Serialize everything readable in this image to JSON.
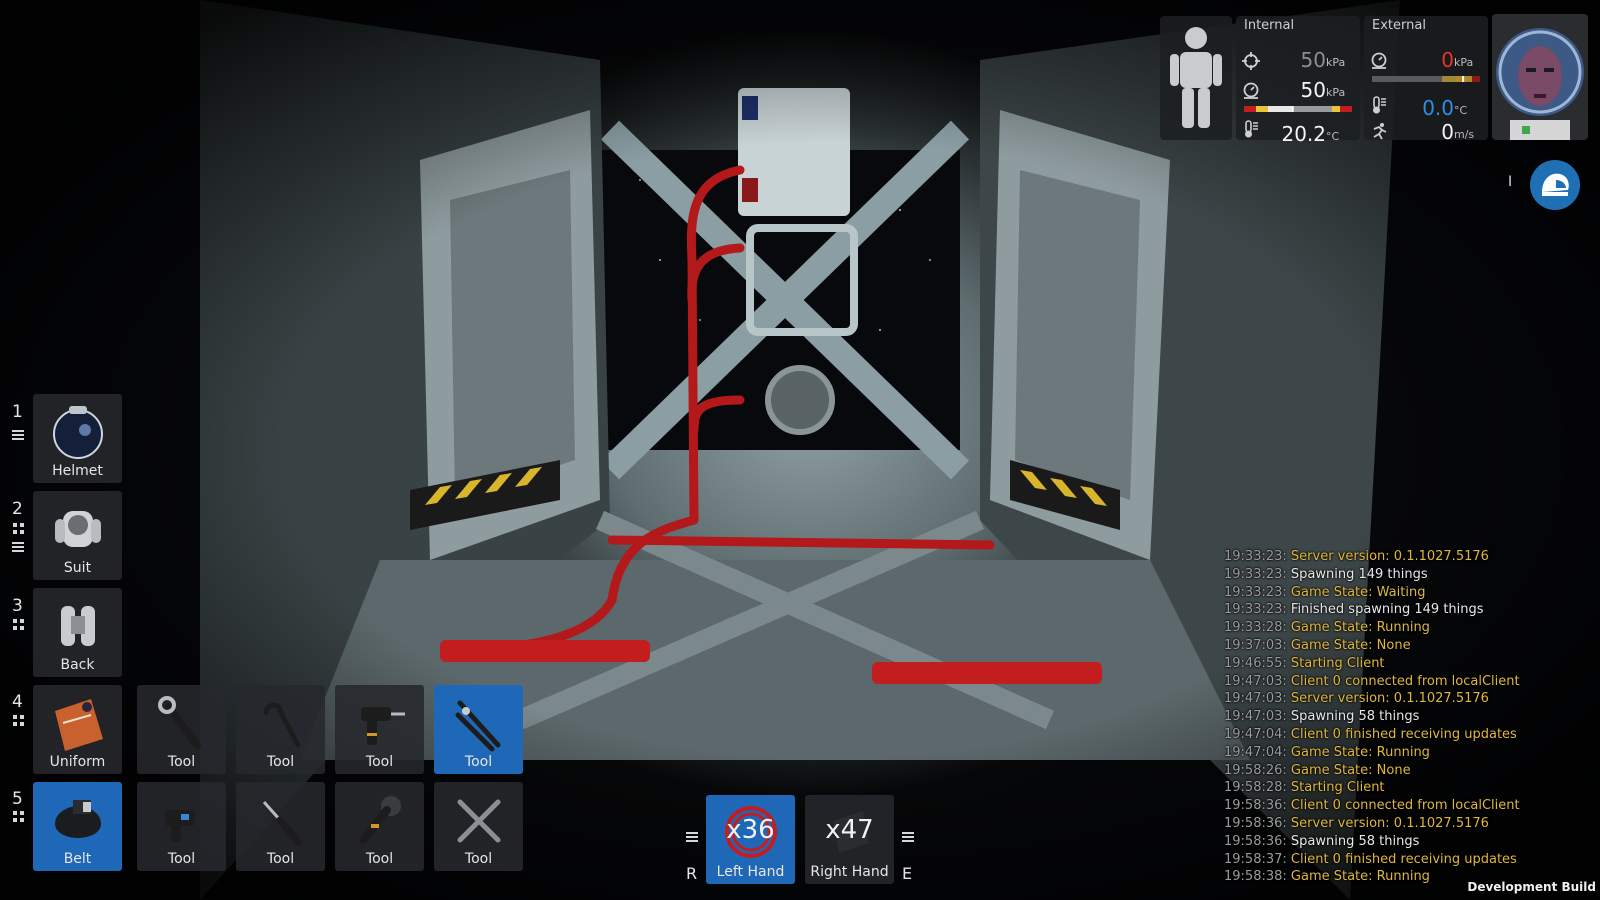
{
  "status_panel": {
    "internal": {
      "title": "Internal",
      "tank_pressure": {
        "value": "50",
        "unit": "kPa"
      },
      "suit_pressure": {
        "value": "50",
        "unit": "kPa"
      },
      "temperature": {
        "value": "20.2",
        "unit": "°C"
      },
      "pressure_gauge_level": 0.45
    },
    "external": {
      "title": "External",
      "pressure": {
        "value": "0",
        "unit": "kPa"
      },
      "temperature": {
        "value": "0.0",
        "unit": "°C"
      },
      "speed": {
        "value": "0",
        "unit": "m/s"
      },
      "pressure_gauge_level": 0.85
    },
    "icons": [
      "body-figure-icon",
      "crosshair-icon",
      "gauge-icon",
      "thermometer-icon",
      "running-figure-icon",
      "helmet-icon"
    ],
    "cursor_text": "I",
    "colors": {
      "danger": "#e8342a",
      "cold": "#2f8de8",
      "accent": "#1f68b8"
    }
  },
  "inventory": {
    "slot_numbers": [
      "1",
      "2",
      "3",
      "4",
      "5"
    ],
    "equipment": [
      {
        "label": "Helmet",
        "icon": "helmet-icon"
      },
      {
        "label": "Suit",
        "icon": "suit-icon"
      },
      {
        "label": "Back",
        "icon": "jetpack-icon"
      },
      {
        "label": "Uniform",
        "icon": "uniform-icon"
      },
      {
        "label": "Belt",
        "icon": "belt-icon",
        "active": true
      }
    ],
    "uniform_slots": [
      {
        "label": "Tool",
        "icon": "wrench-icon"
      },
      {
        "label": "Tool",
        "icon": "crowbar-icon"
      },
      {
        "label": "Tool",
        "icon": "drill-icon"
      },
      {
        "label": "Tool",
        "icon": "cable-cutters-icon",
        "active": true
      }
    ],
    "belt_slots": [
      {
        "label": "Tool",
        "icon": "welder-icon"
      },
      {
        "label": "Tool",
        "icon": "screwdriver-icon"
      },
      {
        "label": "Tool",
        "icon": "angle-grinder-icon"
      },
      {
        "label": "Tool",
        "icon": "multi-tool-icon"
      }
    ]
  },
  "hands": {
    "left": {
      "label": "Left Hand",
      "count": "x36",
      "key": "R",
      "icon": "cable-coil-icon",
      "active": true
    },
    "right": {
      "label": "Right Hand",
      "count": "x47",
      "key": "E",
      "icon": "plate-icon"
    }
  },
  "log": [
    {
      "time": "19:33:23:",
      "message": "Server version: 0.1.1027.5176",
      "kind": "sys"
    },
    {
      "time": "19:33:23:",
      "message": "Spawning 149 things",
      "kind": "info"
    },
    {
      "time": "19:33:23:",
      "message": "Game State: Waiting",
      "kind": "sys"
    },
    {
      "time": "19:33:23:",
      "message": "Finished spawning 149 things",
      "kind": "info"
    },
    {
      "time": "19:33:28:",
      "message": "Game State: Running",
      "kind": "sys"
    },
    {
      "time": "19:37:03:",
      "message": "Game State: None",
      "kind": "sys"
    },
    {
      "time": "19:46:55:",
      "message": "Starting Client",
      "kind": "sys"
    },
    {
      "time": "19:47:03:",
      "message": "Client 0 connected from localClient",
      "kind": "sys"
    },
    {
      "time": "19:47:03:",
      "message": "Server version: 0.1.1027.5176",
      "kind": "sys"
    },
    {
      "time": "19:47:03:",
      "message": "Spawning 58 things",
      "kind": "info"
    },
    {
      "time": "19:47:04:",
      "message": "Client 0 finished receiving updates",
      "kind": "sys"
    },
    {
      "time": "19:47:04:",
      "message": "Game State: Running",
      "kind": "sys"
    },
    {
      "time": "19:58:26:",
      "message": "Game State: None",
      "kind": "sys"
    },
    {
      "time": "19:58:28:",
      "message": "Starting Client",
      "kind": "sys"
    },
    {
      "time": "19:58:36:",
      "message": "Client 0 connected from localClient",
      "kind": "sys"
    },
    {
      "time": "19:58:36:",
      "message": "Server version: 0.1.1027.5176",
      "kind": "sys"
    },
    {
      "time": "19:58:36:",
      "message": "Spawning 58 things",
      "kind": "info"
    },
    {
      "time": "19:58:37:",
      "message": "Client 0 finished receiving updates",
      "kind": "sys"
    },
    {
      "time": "19:58:38:",
      "message": "Game State: Running",
      "kind": "sys"
    }
  ],
  "watermark": "Development Build"
}
